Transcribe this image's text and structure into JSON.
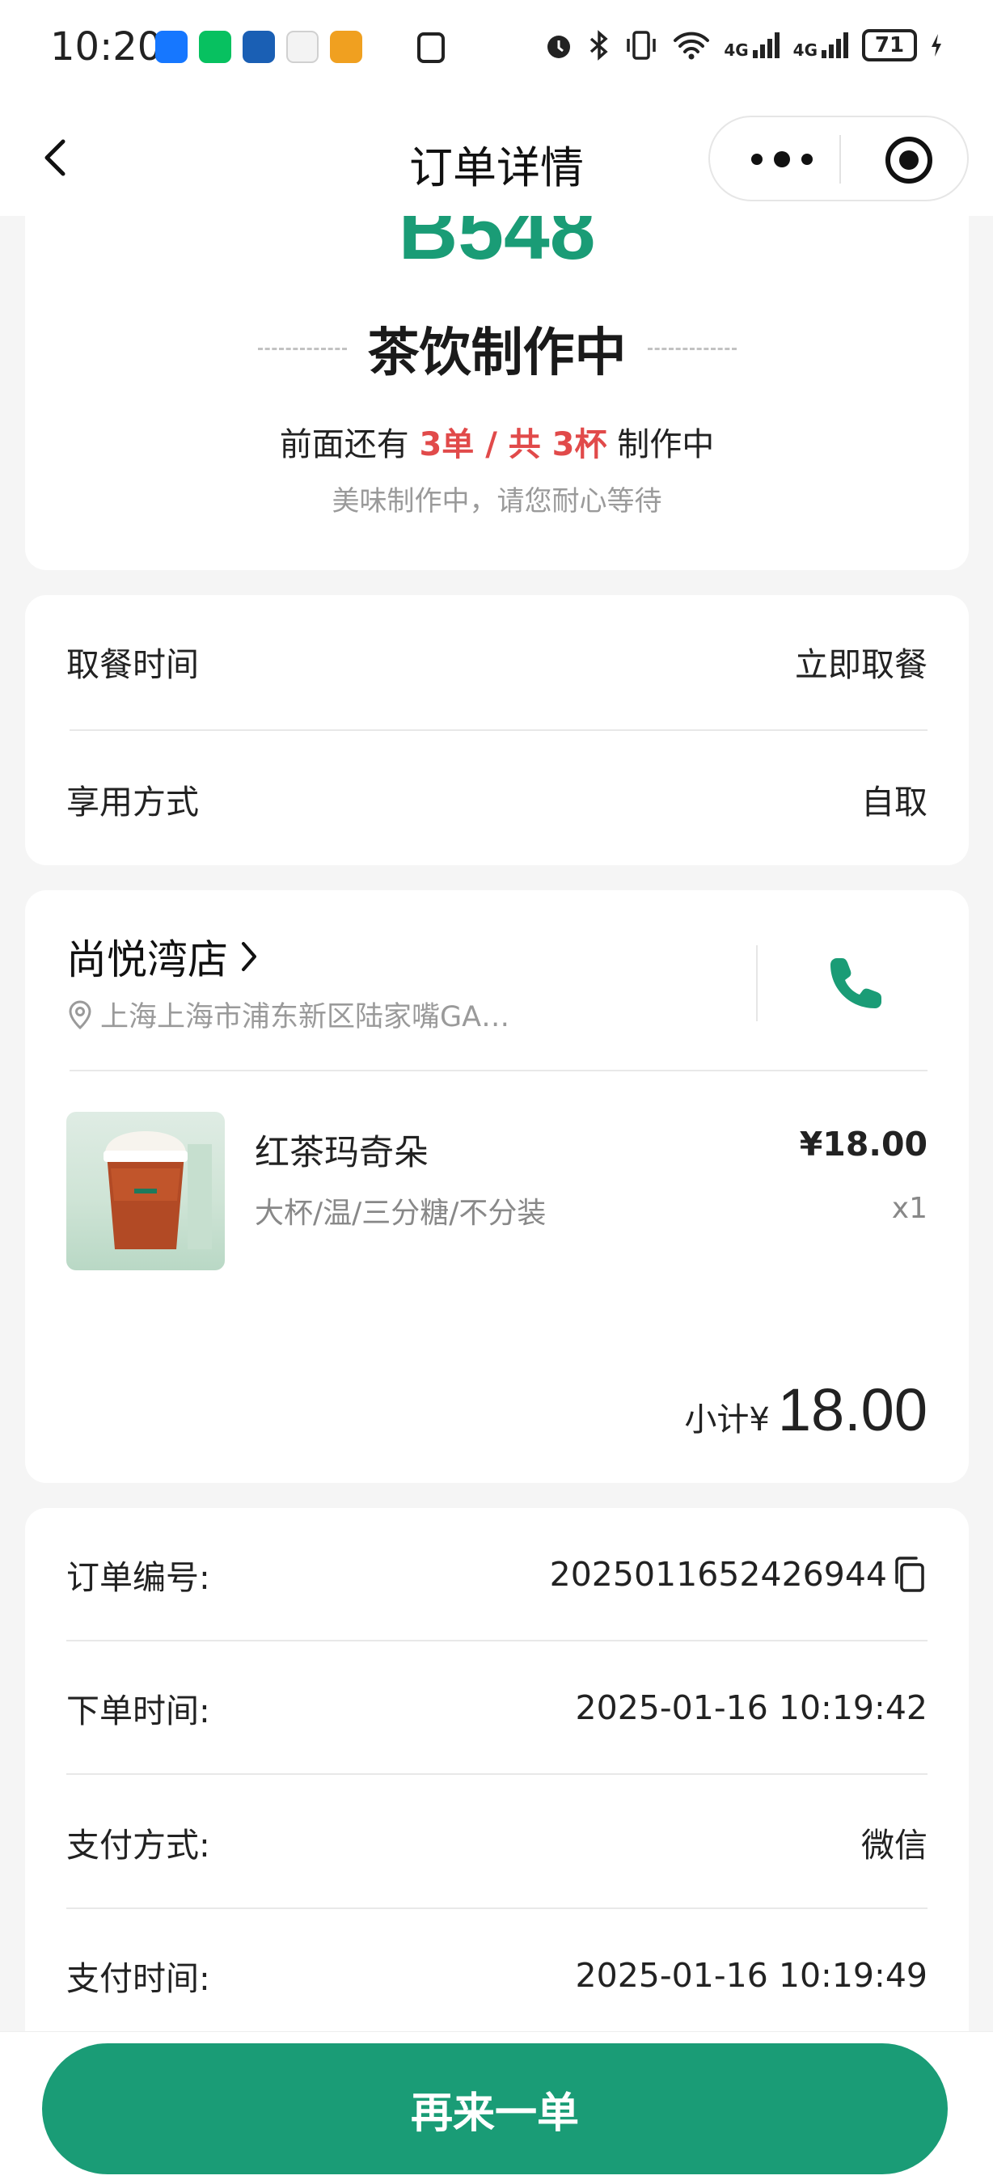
{
  "status_bar": {
    "time": "10:20",
    "signal_1": "4G",
    "signal_2": "4G",
    "battery": "71",
    "app_icon_colors": [
      "#1677ff",
      "#07c160",
      "#1a5fb4",
      "#f5f5f5",
      "#f0a020"
    ]
  },
  "nav": {
    "title": "订单详情"
  },
  "queue": {
    "number": "B548",
    "status": "茶饮制作中",
    "ahead_prefix": "前面还有 ",
    "ahead_count": "3单 / 共 3杯",
    "ahead_suffix": " 制作中",
    "tip": "美味制作中，请您耐心等待"
  },
  "pickup": {
    "time_label": "取餐时间",
    "time_value": "立即取餐",
    "method_label": "享用方式",
    "method_value": "自取"
  },
  "store": {
    "name": "尚悦湾店",
    "address": "上海上海市浦东新区陆家嘴GA…"
  },
  "item": {
    "name": "红茶玛奇朵",
    "spec": "大杯/温/三分糖/不分装",
    "price": "¥18.00",
    "qty": "x1"
  },
  "subtotal": {
    "label": "小计¥",
    "value": "18.00"
  },
  "order_info": {
    "number_label": "订单编号:",
    "number_value": "2025011652426944",
    "created_label": "下单时间:",
    "created_value": "2025-01-16 10:19:42",
    "pay_method_label": "支付方式:",
    "pay_method_value": "微信",
    "pay_time_label": "支付时间:",
    "pay_time_value": "2025-01-16 10:19:49"
  },
  "actions": {
    "reorder": "再来一单"
  },
  "colors": {
    "brand_green": "#1a9c76",
    "highlight_red": "#e14a4a",
    "page_bg": "#f5f5f5"
  }
}
